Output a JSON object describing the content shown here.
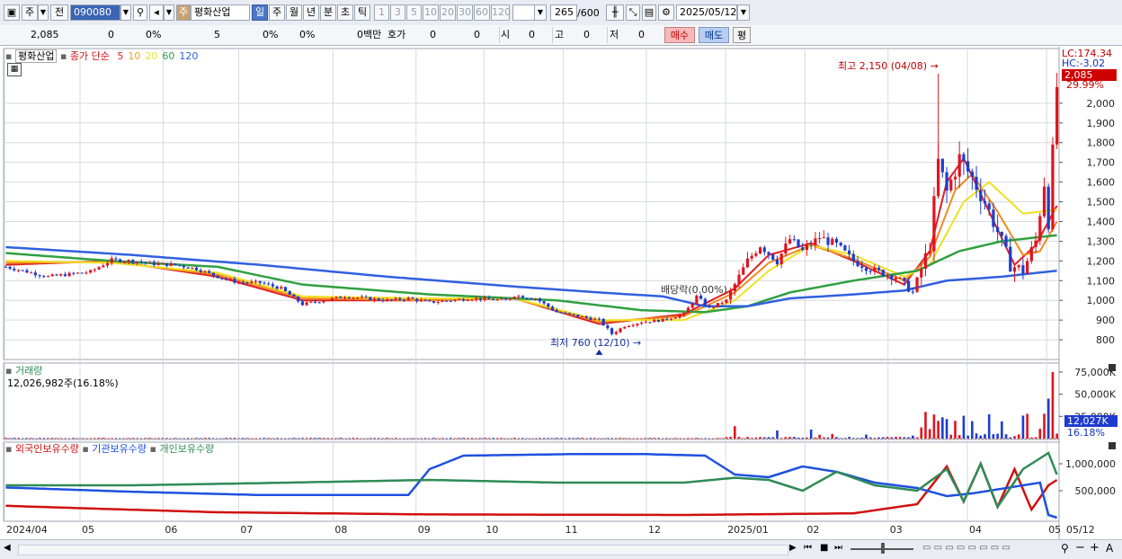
{
  "toolbar": {
    "market": "주",
    "prev": "전",
    "code": "090080",
    "name": "평화산업",
    "periods": [
      "일",
      "주",
      "월",
      "년",
      "분",
      "초",
      "틱"
    ],
    "active_period": "일",
    "minutes": [
      "1",
      "3",
      "5",
      "10",
      "20",
      "30",
      "60",
      "120"
    ],
    "count": "265",
    "count_total": "/600",
    "date": "2025/05/12"
  },
  "quote": {
    "price": "2,085",
    "change": "0",
    "pct": "0%",
    "v5": "5",
    "pct2": "0%",
    "pct3": "0%",
    "amount": "0백만",
    "hoga_label": "호가",
    "hoga1": "0",
    "hoga2": "0",
    "open_label": "시",
    "open": "0",
    "high_label": "고",
    "high": "0",
    "low_label": "저",
    "low": "0",
    "buy": "매수",
    "sell": "매도",
    "avg": "평"
  },
  "legend": {
    "stock": "평화산업",
    "ma_label": "종가 단순",
    "ma_periods": [
      "5",
      "10",
      "20",
      "60",
      "120"
    ],
    "ma_colors": [
      "#e02020",
      "#f0a020",
      "#f0e020",
      "#30a040",
      "#3060e0"
    ]
  },
  "colors": {
    "up": "#e0141e",
    "down": "#1e3ccf",
    "grid": "#d6d9de"
  },
  "right_info": {
    "lc": "LC:174.34",
    "hc": "HC:-3.02",
    "last_price": "2,085",
    "pct": "29.99%"
  },
  "annotations": {
    "high": "최고 2,150 (04/08)",
    "low": "최저 760 (12/10)",
    "dividend": "배당락(0.00%)"
  },
  "volume_panel": {
    "title": "거래량",
    "info": "12,026,982주(16.18%)",
    "ticks": [
      "75,000K",
      "50,000K",
      "25,000K"
    ],
    "last": "12,027K",
    "pct": "16.18%"
  },
  "holding_panel": {
    "series": [
      "외국인보유수량",
      "기관보유수량",
      "개인보유수량"
    ],
    "series_colors": [
      "#d01010",
      "#1e50e0",
      "#2e8b57"
    ],
    "ticks": [
      "1,000,000",
      "500,000"
    ]
  },
  "chart_data": {
    "type": "candlestick",
    "x_labels": [
      "2024/04",
      "05",
      "06",
      "07",
      "08",
      "09",
      "10",
      "11",
      "12",
      "2025/01",
      "02",
      "03",
      "04",
      "05",
      "05/12"
    ],
    "y_ticks": [
      800,
      900,
      1000,
      1100,
      1200,
      1300,
      1400,
      1500,
      1600,
      1700,
      1800,
      1900,
      2000
    ],
    "ylim": [
      700,
      2250
    ],
    "price_path": [
      [
        0,
        1170
      ],
      [
        10,
        1120
      ],
      [
        20,
        1145
      ],
      [
        25,
        1205
      ],
      [
        30,
        1200
      ],
      [
        35,
        1185
      ],
      [
        40,
        1180
      ],
      [
        45,
        1160
      ],
      [
        50,
        1120
      ],
      [
        55,
        1090
      ],
      [
        60,
        1090
      ],
      [
        65,
        1060
      ],
      [
        70,
        980
      ],
      [
        75,
        1000
      ],
      [
        80,
        1020
      ],
      [
        85,
        1010
      ],
      [
        90,
        1000
      ],
      [
        95,
        1010
      ],
      [
        100,
        990
      ],
      [
        110,
        1010
      ],
      [
        118,
        1000
      ],
      [
        120,
        1025
      ],
      [
        125,
        1010
      ],
      [
        130,
        940
      ],
      [
        135,
        920
      ],
      [
        140,
        900
      ],
      [
        143,
        830
      ],
      [
        146,
        870
      ],
      [
        150,
        890
      ],
      [
        155,
        900
      ],
      [
        160,
        930
      ],
      [
        163,
        1020
      ],
      [
        166,
        960
      ],
      [
        170,
        1000
      ],
      [
        172,
        1080
      ],
      [
        175,
        1200
      ],
      [
        178,
        1280
      ],
      [
        182,
        1200
      ],
      [
        185,
        1310
      ],
      [
        188,
        1250
      ],
      [
        192,
        1320
      ],
      [
        196,
        1280
      ],
      [
        200,
        1200
      ],
      [
        205,
        1150
      ],
      [
        210,
        1120
      ],
      [
        214,
        1040
      ],
      [
        218,
        1280
      ],
      [
        220,
        1700
      ],
      [
        222,
        1550
      ],
      [
        225,
        1720
      ],
      [
        228,
        1620
      ],
      [
        231,
        1500
      ],
      [
        234,
        1350
      ],
      [
        237,
        1180
      ],
      [
        240,
        1150
      ],
      [
        243,
        1300
      ],
      [
        245,
        1600
      ],
      [
        246,
        1400
      ],
      [
        248,
        2085
      ]
    ],
    "ma": {
      "5": [
        [
          0,
          1180
        ],
        [
          25,
          1200
        ],
        [
          50,
          1120
        ],
        [
          70,
          1000
        ],
        [
          100,
          1000
        ],
        [
          120,
          1010
        ],
        [
          140,
          880
        ],
        [
          160,
          930
        ],
        [
          172,
          1060
        ],
        [
          180,
          1230
        ],
        [
          190,
          1290
        ],
        [
          200,
          1200
        ],
        [
          212,
          1080
        ],
        [
          218,
          1250
        ],
        [
          222,
          1600
        ],
        [
          226,
          1720
        ],
        [
          232,
          1450
        ],
        [
          238,
          1180
        ],
        [
          243,
          1280
        ],
        [
          248,
          1480
        ]
      ],
      "10": [
        [
          0,
          1190
        ],
        [
          25,
          1195
        ],
        [
          50,
          1130
        ],
        [
          70,
          1010
        ],
        [
          100,
          1000
        ],
        [
          120,
          1010
        ],
        [
          140,
          890
        ],
        [
          160,
          920
        ],
        [
          172,
          1040
        ],
        [
          180,
          1190
        ],
        [
          190,
          1280
        ],
        [
          200,
          1210
        ],
        [
          212,
          1100
        ],
        [
          218,
          1220
        ],
        [
          224,
          1560
        ],
        [
          228,
          1640
        ],
        [
          234,
          1450
        ],
        [
          240,
          1230
        ],
        [
          244,
          1250
        ],
        [
          248,
          1400
        ]
      ],
      "20": [
        [
          0,
          1200
        ],
        [
          25,
          1190
        ],
        [
          50,
          1140
        ],
        [
          70,
          1020
        ],
        [
          100,
          1010
        ],
        [
          120,
          1010
        ],
        [
          140,
          900
        ],
        [
          160,
          900
        ],
        [
          172,
          1000
        ],
        [
          180,
          1150
        ],
        [
          190,
          1280
        ],
        [
          200,
          1230
        ],
        [
          212,
          1120
        ],
        [
          218,
          1180
        ],
        [
          226,
          1500
        ],
        [
          232,
          1600
        ],
        [
          240,
          1440
        ],
        [
          248,
          1460
        ]
      ],
      "60": [
        [
          0,
          1240
        ],
        [
          25,
          1200
        ],
        [
          50,
          1170
        ],
        [
          70,
          1080
        ],
        [
          100,
          1030
        ],
        [
          130,
          1000
        ],
        [
          150,
          950
        ],
        [
          165,
          940
        ],
        [
          175,
          970
        ],
        [
          185,
          1040
        ],
        [
          200,
          1100
        ],
        [
          215,
          1150
        ],
        [
          225,
          1250
        ],
        [
          235,
          1300
        ],
        [
          248,
          1330
        ]
      ],
      "120": [
        [
          0,
          1270
        ],
        [
          30,
          1230
        ],
        [
          60,
          1180
        ],
        [
          90,
          1120
        ],
        [
          120,
          1070
        ],
        [
          140,
          1040
        ],
        [
          155,
          1020
        ],
        [
          165,
          970
        ],
        [
          175,
          970
        ],
        [
          185,
          1010
        ],
        [
          200,
          1030
        ],
        [
          212,
          1050
        ],
        [
          222,
          1100
        ],
        [
          235,
          1120
        ],
        [
          248,
          1150
        ]
      ]
    },
    "holdings": {
      "foreign": [
        [
          0,
          220000
        ],
        [
          20,
          170000
        ],
        [
          50,
          100000
        ],
        [
          100,
          60000
        ],
        [
          160,
          50000
        ],
        [
          200,
          80000
        ],
        [
          215,
          250000
        ],
        [
          222,
          950000
        ],
        [
          226,
          300000
        ],
        [
          230,
          1000000
        ],
        [
          234,
          200000
        ],
        [
          238,
          900000
        ],
        [
          242,
          150000
        ],
        [
          246,
          600000
        ],
        [
          248,
          700000
        ]
      ],
      "institution": [
        [
          0,
          560000
        ],
        [
          30,
          480000
        ],
        [
          60,
          420000
        ],
        [
          95,
          420000
        ],
        [
          100,
          900000
        ],
        [
          108,
          1150000
        ],
        [
          135,
          1180000
        ],
        [
          150,
          1180000
        ],
        [
          165,
          1150000
        ],
        [
          172,
          800000
        ],
        [
          180,
          750000
        ],
        [
          188,
          950000
        ],
        [
          196,
          850000
        ],
        [
          205,
          650000
        ],
        [
          215,
          550000
        ],
        [
          222,
          400000
        ],
        [
          228,
          450000
        ],
        [
          236,
          550000
        ],
        [
          244,
          650000
        ],
        [
          246,
          50000
        ],
        [
          248,
          0
        ]
      ],
      "individual": [
        [
          0,
          600000
        ],
        [
          30,
          600000
        ],
        [
          60,
          640000
        ],
        [
          100,
          700000
        ],
        [
          130,
          650000
        ],
        [
          160,
          650000
        ],
        [
          172,
          740000
        ],
        [
          180,
          700000
        ],
        [
          188,
          500000
        ],
        [
          196,
          850000
        ],
        [
          205,
          600000
        ],
        [
          215,
          500000
        ],
        [
          222,
          900000
        ],
        [
          226,
          300000
        ],
        [
          230,
          1000000
        ],
        [
          234,
          200000
        ],
        [
          240,
          900000
        ],
        [
          246,
          1200000
        ],
        [
          248,
          800000
        ]
      ]
    }
  }
}
